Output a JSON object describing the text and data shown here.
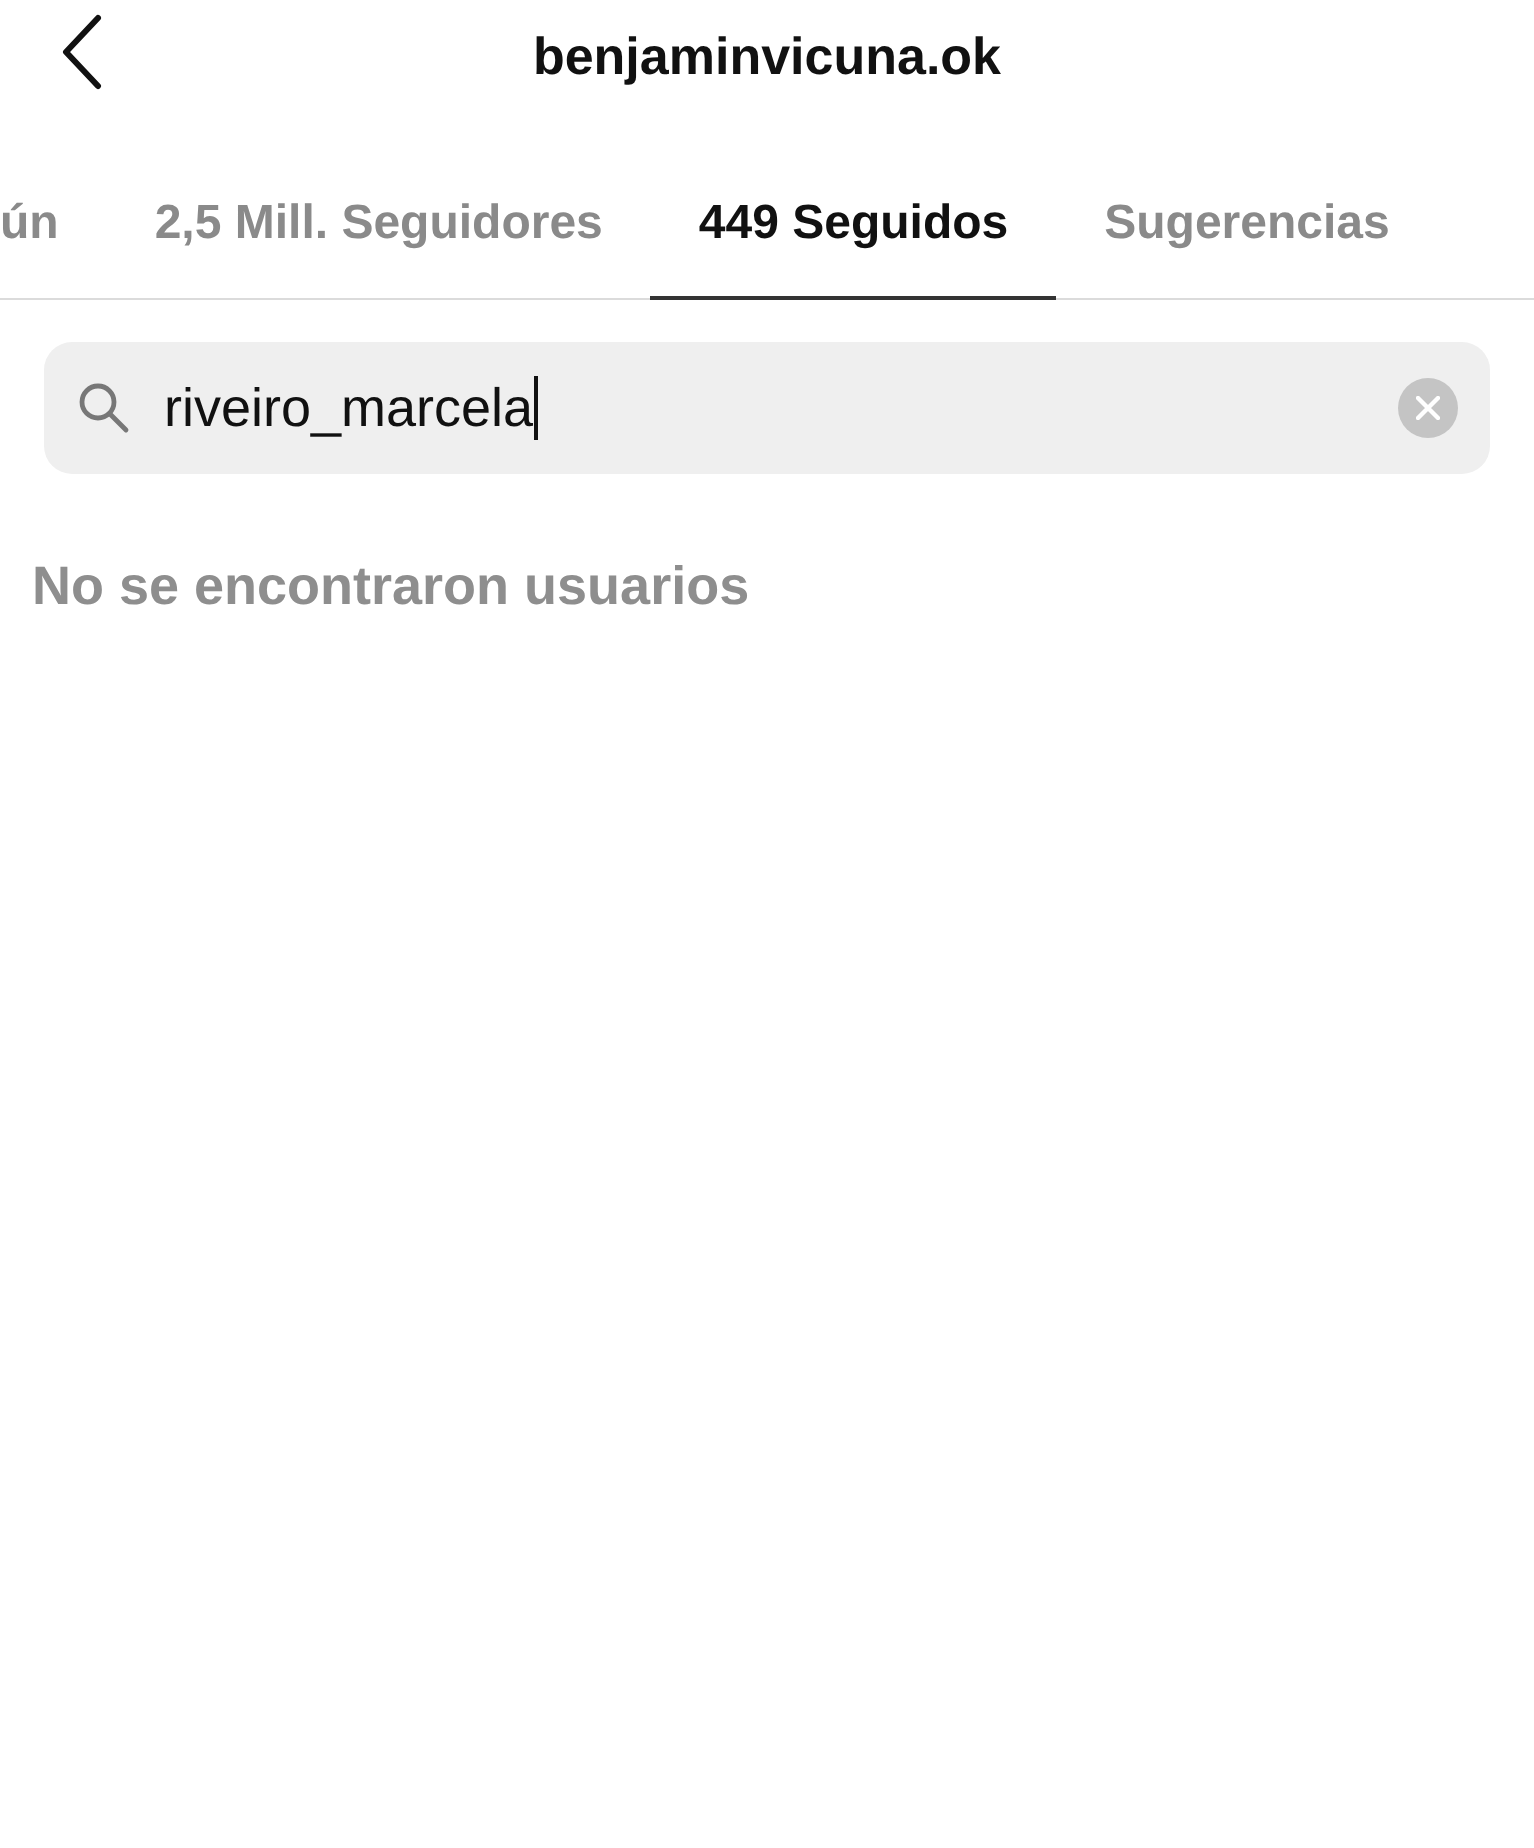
{
  "header": {
    "title": "benjaminvicuna.ok"
  },
  "tabs": [
    {
      "label": "ún",
      "selected": false
    },
    {
      "label": "2,5 Mill. Seguidores",
      "selected": false
    },
    {
      "label": "449 Seguidos",
      "selected": true
    },
    {
      "label": "Sugerencias",
      "selected": false
    }
  ],
  "search": {
    "value": "riveiro_marcela"
  },
  "message": "No se encontraron usuarios"
}
